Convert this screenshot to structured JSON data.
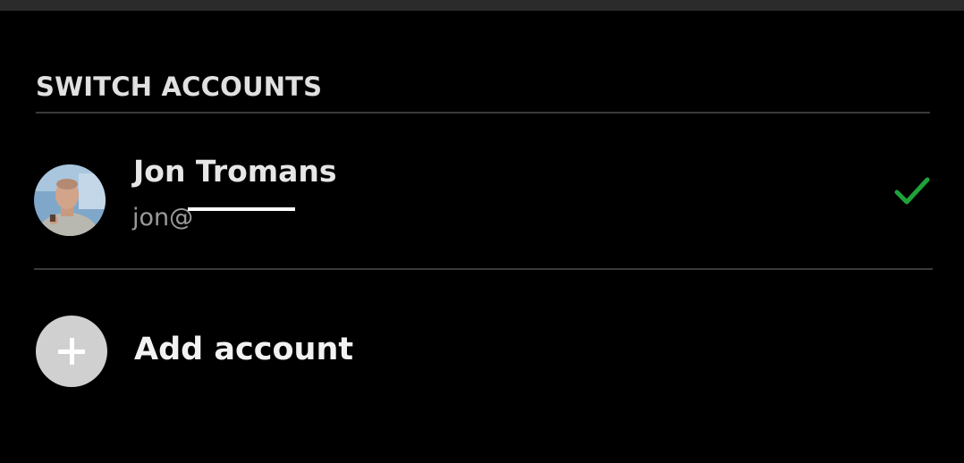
{
  "header": {
    "title": "SWITCH ACCOUNTS"
  },
  "accounts": [
    {
      "name": "Jon Tromans",
      "email": "jon@",
      "selected": true,
      "avatar_icon": "user-photo"
    }
  ],
  "add_account": {
    "label": "Add account",
    "icon": "plus-icon"
  },
  "colors": {
    "background": "#000000",
    "check": "#1fa23a",
    "add_circle": "#d0d0d0",
    "divider": "#3a3a3a"
  }
}
